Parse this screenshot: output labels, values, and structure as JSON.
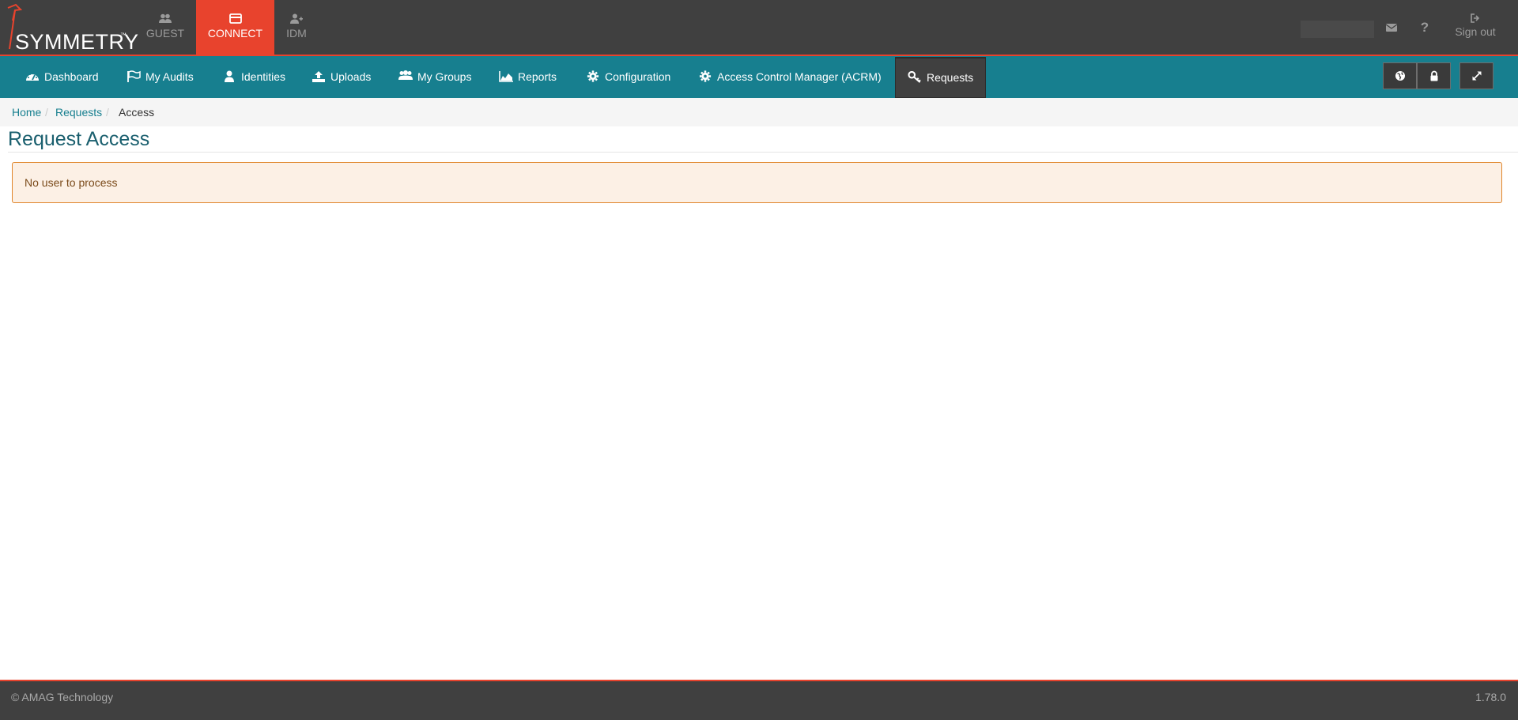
{
  "brand": {
    "name": "SYMMETRY",
    "trademark": "™"
  },
  "app_tabs": [
    {
      "label": "GUEST",
      "icon": "users-icon",
      "active": false
    },
    {
      "label": "CONNECT",
      "icon": "card-icon",
      "active": true
    },
    {
      "label": "IDM",
      "icon": "user-plus-icon",
      "active": false
    }
  ],
  "top_right": {
    "signout_label": "Sign out",
    "help_label": "?"
  },
  "nav": {
    "items": [
      {
        "label": "Dashboard",
        "icon": "dashboard-icon"
      },
      {
        "label": "My Audits",
        "icon": "flag-icon"
      },
      {
        "label": "Identities",
        "icon": "user-icon"
      },
      {
        "label": "Uploads",
        "icon": "upload-icon"
      },
      {
        "label": "My Groups",
        "icon": "group-icon"
      },
      {
        "label": "Reports",
        "icon": "area-chart-icon"
      },
      {
        "label": "Configuration",
        "icon": "gear-icon"
      },
      {
        "label": "Access Control Manager (ACRM)",
        "icon": "gear-icon"
      },
      {
        "label": "Requests",
        "icon": "key-icon",
        "active": true
      }
    ],
    "buttons": [
      "globe-icon",
      "lock-icon",
      "expand-icon"
    ]
  },
  "breadcrumb": [
    "Home",
    "Requests",
    "Access"
  ],
  "page": {
    "title": "Request Access",
    "alert": "No user to process"
  },
  "footer": {
    "copyright": "© AMAG Technology",
    "version": "1.78.0"
  },
  "colors": {
    "topbar": "#404040",
    "accent": "#e8432d",
    "navbar": "#177f8f",
    "alert_bg": "#fcf0e5",
    "alert_border": "#e0852a"
  }
}
